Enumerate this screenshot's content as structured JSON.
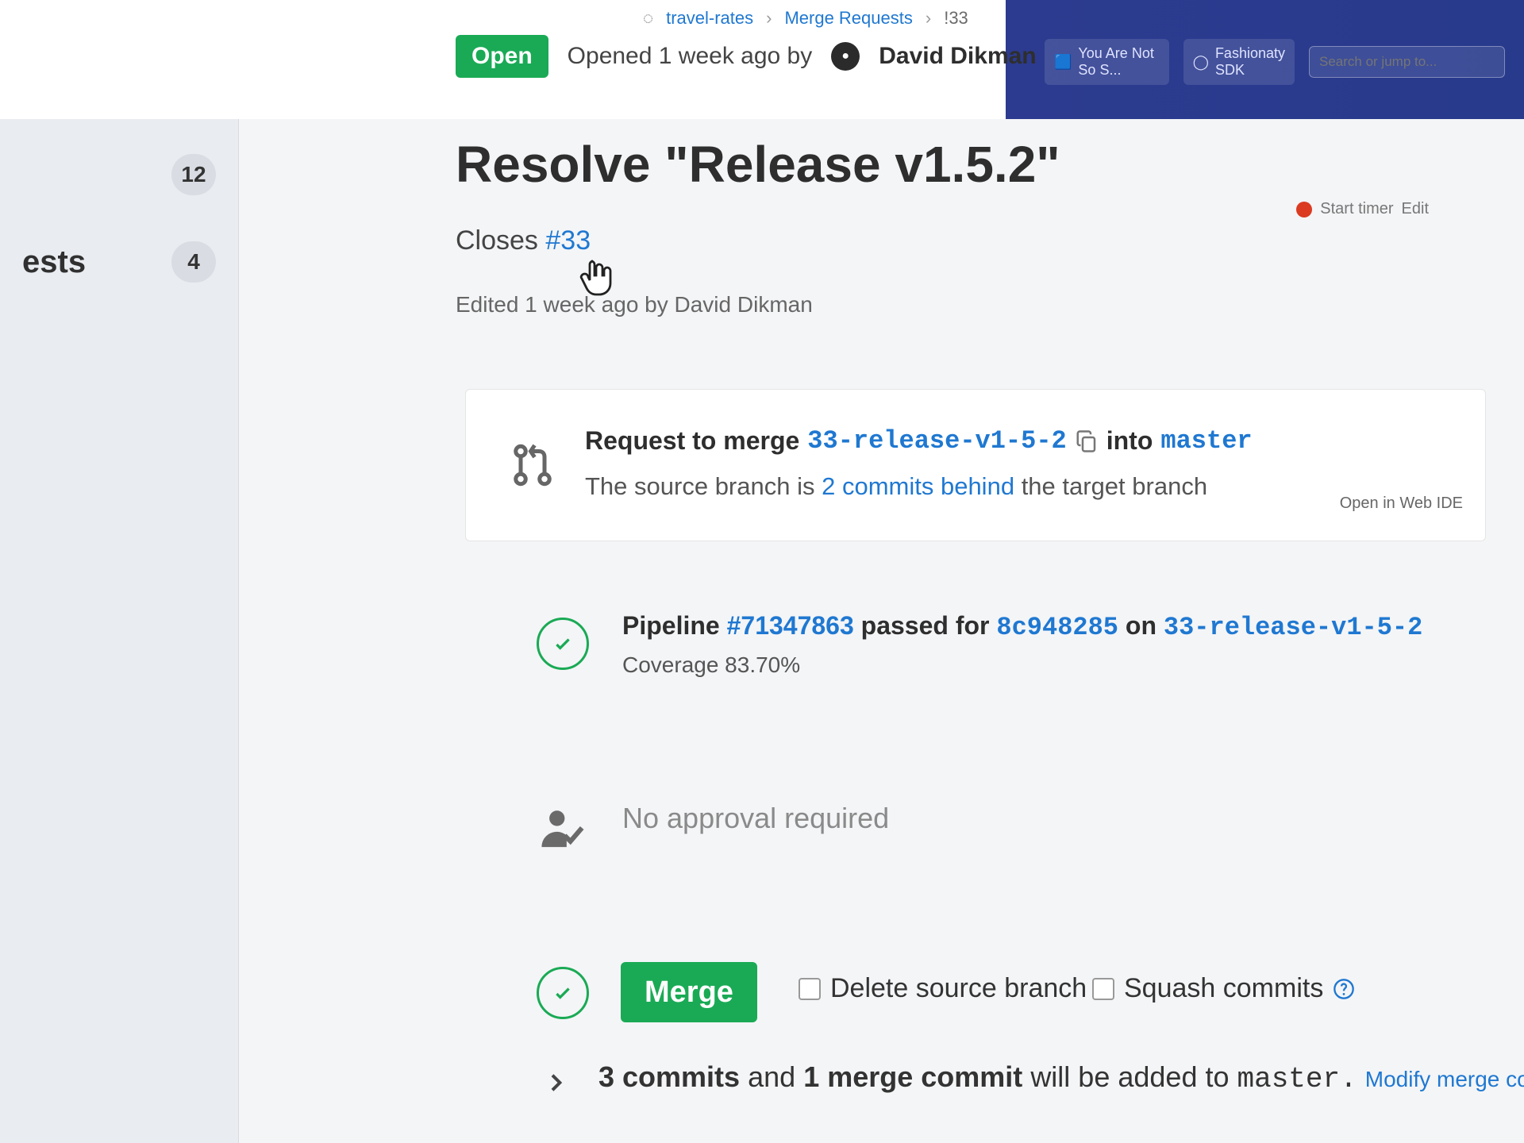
{
  "sidebar": {
    "items": [
      {
        "label": "",
        "count": "12"
      },
      {
        "label": "ests",
        "count": "4"
      }
    ]
  },
  "topnav": {
    "tab_label": "You Are Not So S...",
    "gh_label": "Fashionaty SDK",
    "search_placeholder": "Search or jump to..."
  },
  "breadcrumb": [
    "travel-rates",
    "Merge Requests",
    "!33"
  ],
  "status": {
    "badge": "Open",
    "opened_text": "Opened 1 week ago by",
    "author": "David Dikman"
  },
  "title": "Resolve \"Release v1.5.2\"",
  "closes": {
    "prefix": "Closes",
    "issue": "#33"
  },
  "edited": "Edited 1 week ago by David Dikman",
  "timer": {
    "label": "Start timer",
    "edit": "Edit"
  },
  "merge_request": {
    "label_prefix": "Request to merge",
    "source_branch": "33-release-v1-5-2",
    "into": "into",
    "target_branch": "master",
    "behind_prefix": "The source branch is",
    "behind_link": "2 commits behind",
    "behind_suffix": "the target branch",
    "open_ide": "Open in Web IDE"
  },
  "pipeline": {
    "label": "Pipeline",
    "id": "#71347863",
    "passed_for": "passed for",
    "commit": "8c948285",
    "on": "on",
    "branch": "33-release-v1-5-2",
    "coverage": "Coverage 83.70%"
  },
  "approval": {
    "text": "No approval required"
  },
  "merge": {
    "button": "Merge",
    "delete_source": "Delete source branch",
    "squash": "Squash commits"
  },
  "commits": {
    "count_text": "3 commits",
    "and": "and",
    "merge_commit": "1 merge commit",
    "will_be_added": "will be added to",
    "target": "master.",
    "modify": "Modify merge commit"
  },
  "colors": {
    "accent_green": "#1aaa55",
    "link_blue": "#1f78d1",
    "nav_blue": "#283a8c"
  }
}
